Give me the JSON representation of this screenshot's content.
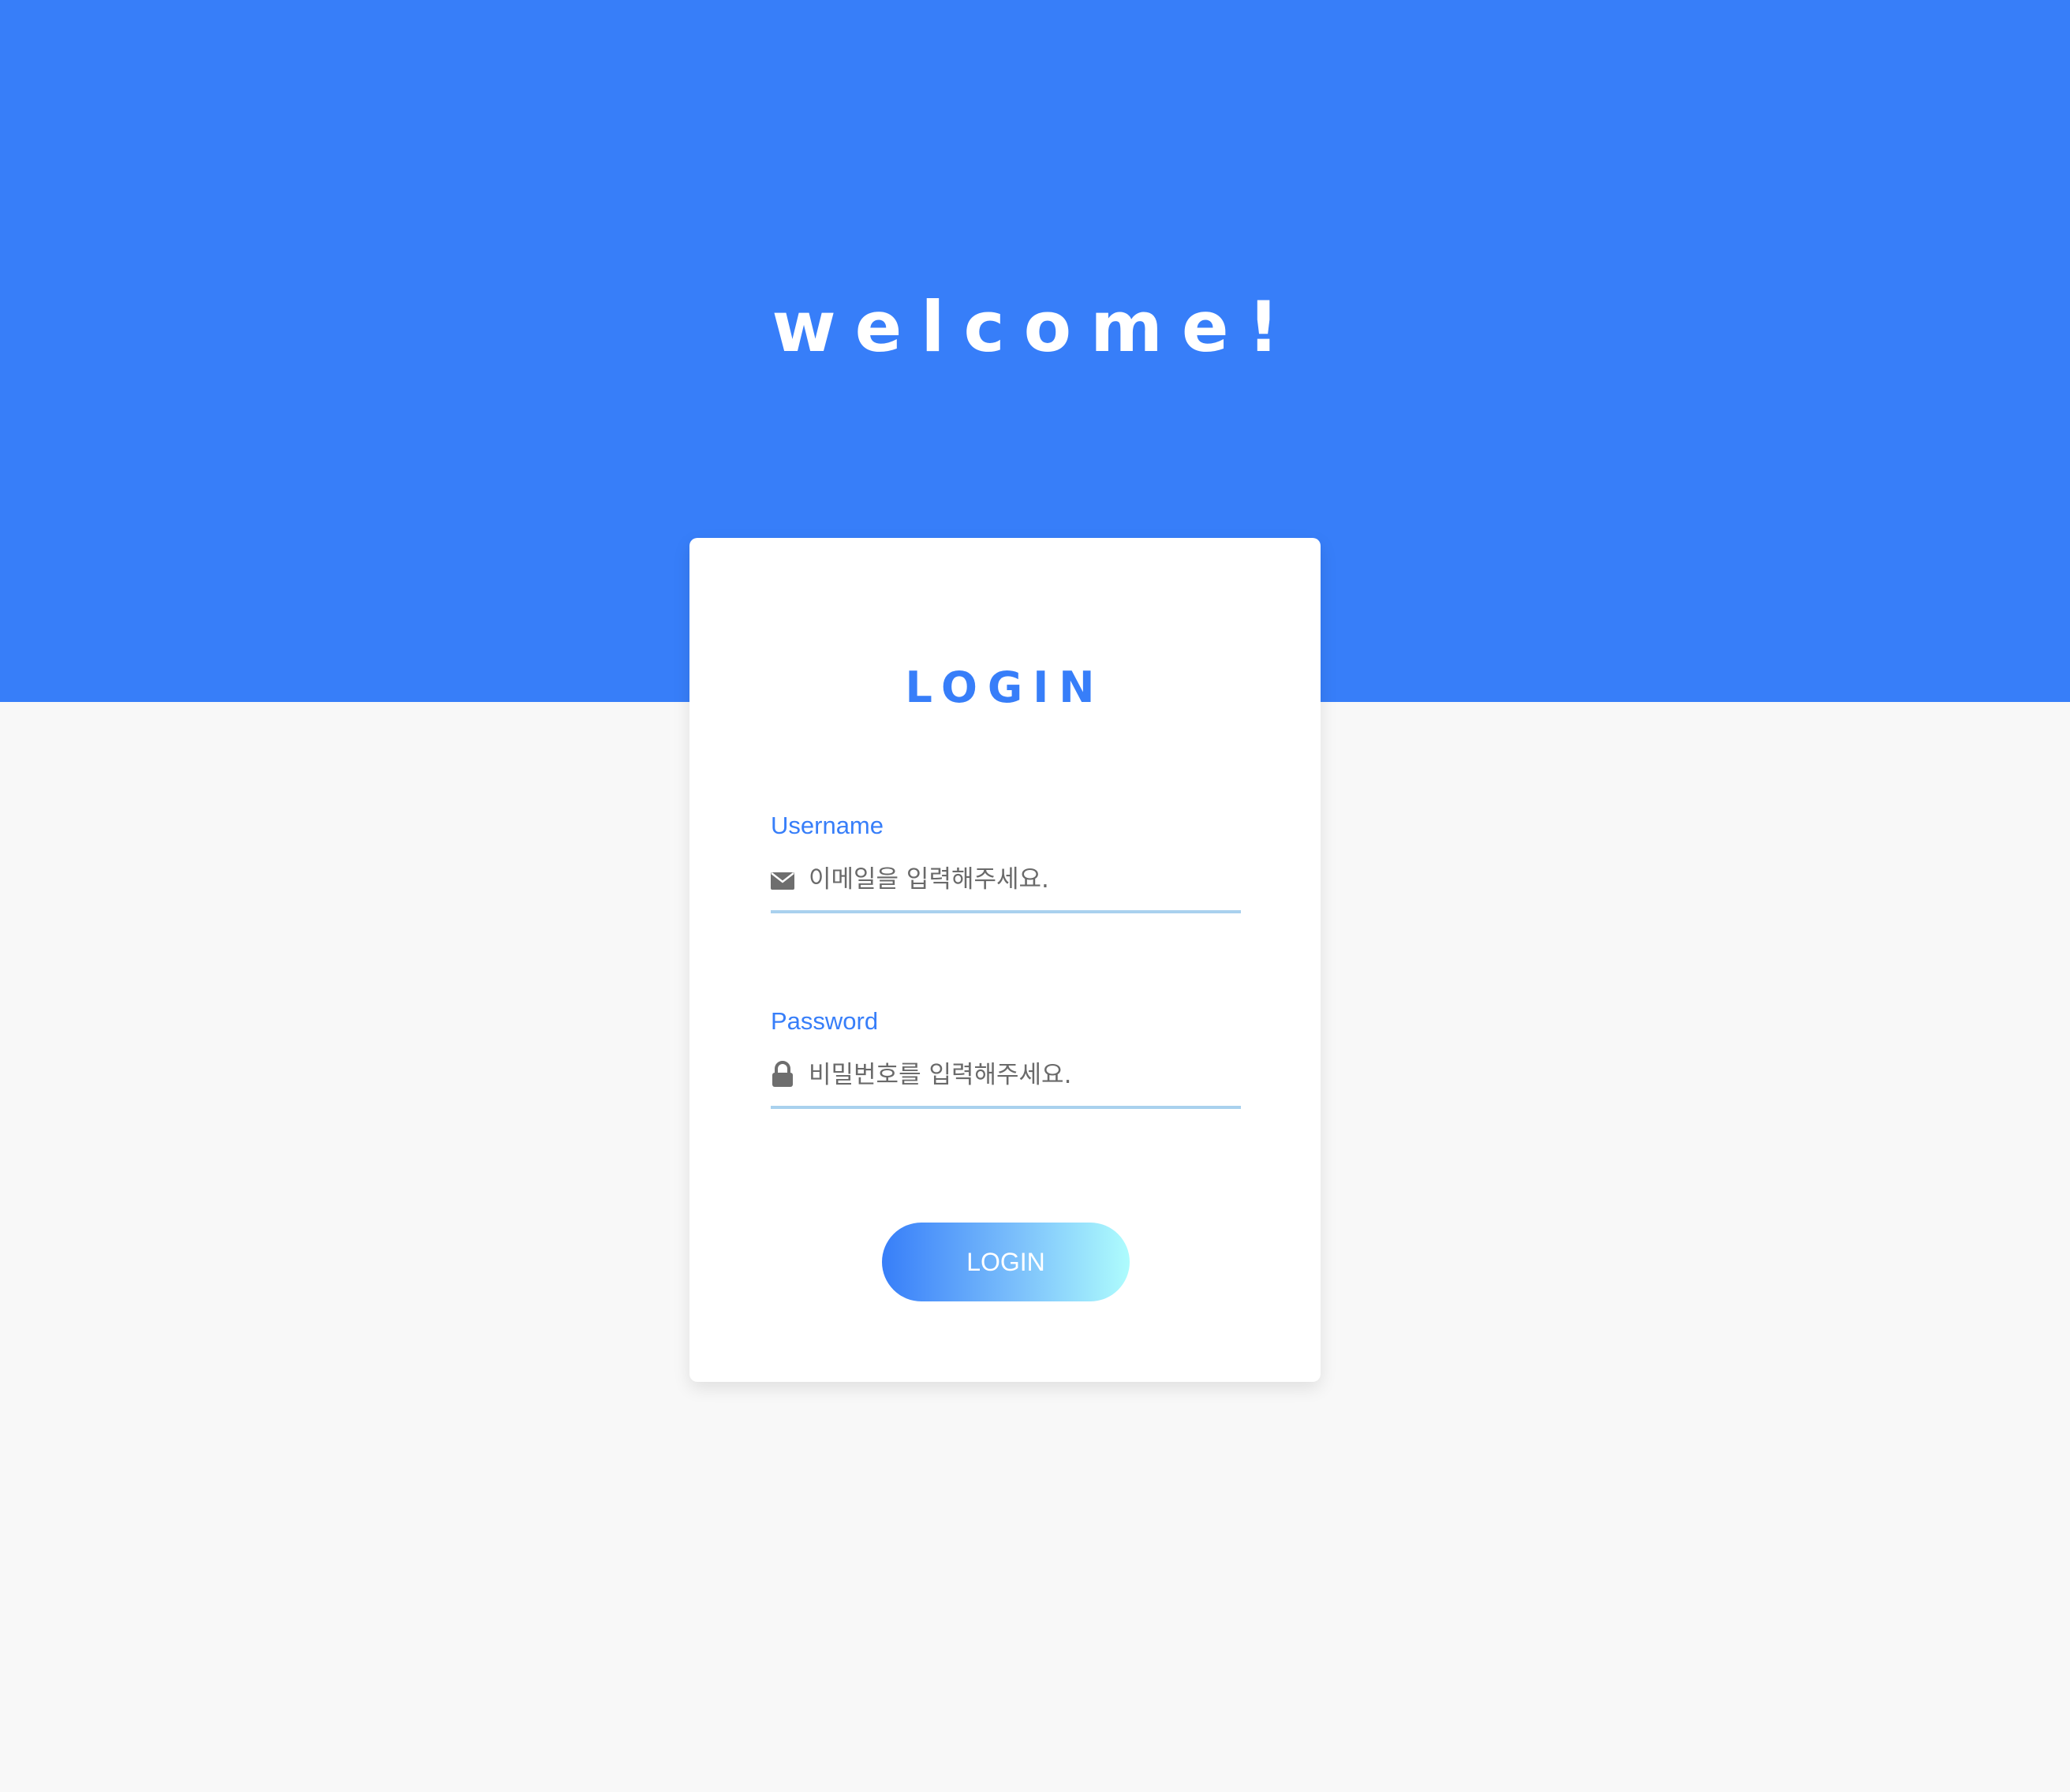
{
  "hero": {
    "title": "welcome!",
    "background_color": "#377ef9"
  },
  "login_card": {
    "title": "LOGIN",
    "fields": [
      {
        "label": "Username",
        "icon": "envelope-icon",
        "value": "",
        "placeholder": "이메일을 입력해주세요."
      },
      {
        "label": "Password",
        "icon": "lock-icon",
        "value": "",
        "placeholder": "비밀번호를 입력해주세요."
      }
    ],
    "button_label": "LOGIN"
  },
  "colors": {
    "accent": "#377ef9",
    "page_background": "#f8f8f8",
    "input_underline": "#a9d1ee",
    "button_gradient_start": "#377ef9",
    "button_gradient_end": "#aefcfd"
  }
}
